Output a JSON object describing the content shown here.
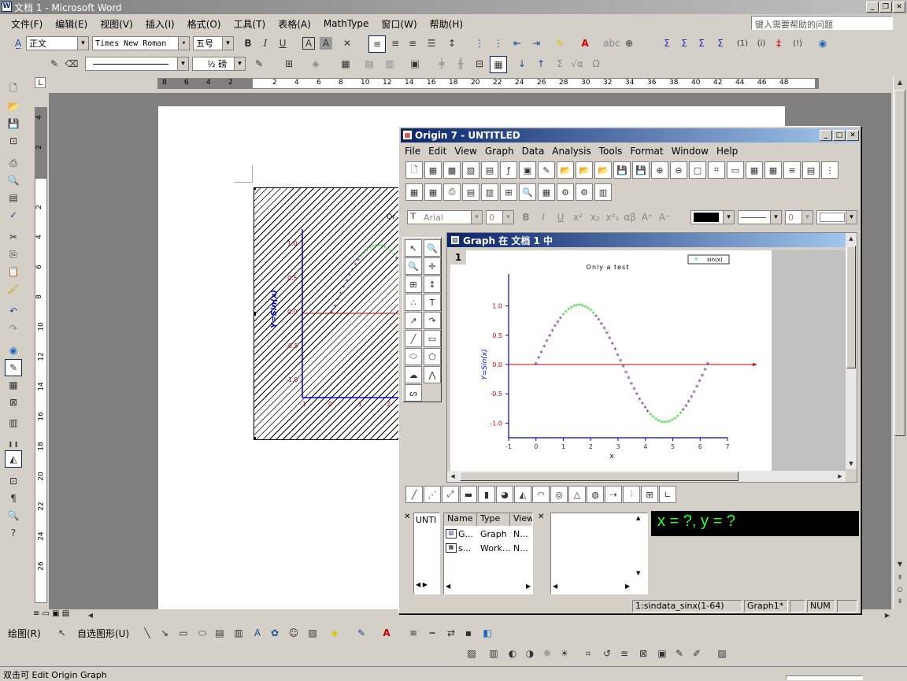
{
  "word": {
    "title": "文档 1 - Microsoft Word",
    "menu": [
      "文件(F)",
      "编辑(E)",
      "视图(V)",
      "插入(I)",
      "格式(O)",
      "工具(T)",
      "表格(A)",
      "MathType",
      "窗口(W)",
      "帮助(H)"
    ],
    "help_placeholder": "键入需要帮助的问题",
    "style": "正文",
    "font": "Times New Roman",
    "size": "五号",
    "line_weight": "½ 磅",
    "ruler_ticks": [
      "8",
      "6",
      "4",
      "2",
      "",
      "2",
      "4",
      "6",
      "8",
      "10",
      "12",
      "14",
      "16",
      "18",
      "20",
      "22",
      "24",
      "26",
      "28",
      "30",
      "32",
      "34",
      "36",
      "38",
      "40",
      "42",
      "44",
      "46",
      "48"
    ],
    "vruler_ticks": [
      "4",
      "2",
      "",
      "2",
      "4",
      "6",
      "8",
      "10",
      "12",
      "14",
      "16",
      "18",
      "20",
      "22",
      "24",
      "26"
    ],
    "drawing_toolbar": {
      "draw": "绘图(R)",
      "autoshapes": "自选图形(U)"
    },
    "status": "双击可 Edit Origin Graph"
  },
  "embedded_graph": {
    "title": "Or",
    "ylabel": "Y=Sin(x)",
    "yticks": [
      "1.0",
      "0.5",
      "0.0",
      "-0.5",
      "-1.0"
    ],
    "xticks": [
      "-1",
      "0",
      "1",
      "2"
    ]
  },
  "origin": {
    "title": "Origin 7 - UNTITLED",
    "menu": [
      "File",
      "Edit",
      "View",
      "Graph",
      "Data",
      "Analysis",
      "Tools",
      "Format",
      "Window",
      "Help"
    ],
    "font": "Arial",
    "font_size": "0",
    "line_size": "0",
    "graph_window_title": "Graph 在 文档 1 中",
    "layer": "1",
    "coord_readout": "x = ?, y = ?",
    "project": {
      "root": "UNTI",
      "columns": [
        "Name",
        "Type",
        "View"
      ],
      "rows": [
        [
          "G...",
          "Graph",
          "N..."
        ],
        [
          "s...",
          "Work...",
          "N..."
        ]
      ]
    },
    "status": {
      "dataset": "1:sindata_sinx(1-64)",
      "graph": "Graph1*",
      "num": "NUM"
    }
  },
  "chart_data": {
    "type": "scatter",
    "title": "Only a test",
    "xlabel": "x",
    "ylabel": "Y=Sin(x)",
    "xlim": [
      -1,
      7
    ],
    "ylim": [
      -1.25,
      1.25
    ],
    "xticks": [
      "-1",
      "0",
      "1",
      "2",
      "3",
      "4",
      "5",
      "6",
      "7"
    ],
    "yticks": [
      "1.0",
      "0.5",
      "0.0",
      "-0.5",
      "-1.0"
    ],
    "legend": {
      "label": "sin(x)",
      "position": "top-right"
    },
    "series": [
      {
        "name": "sin(x)",
        "function": "sin(x)",
        "x_start": 0,
        "x_end": 6.28,
        "points": 64,
        "colors": [
          "#2ecc2e",
          "#5a1a7a"
        ]
      }
    ],
    "baseline_color": "#cc0000",
    "axis_color": "#0000cc"
  }
}
